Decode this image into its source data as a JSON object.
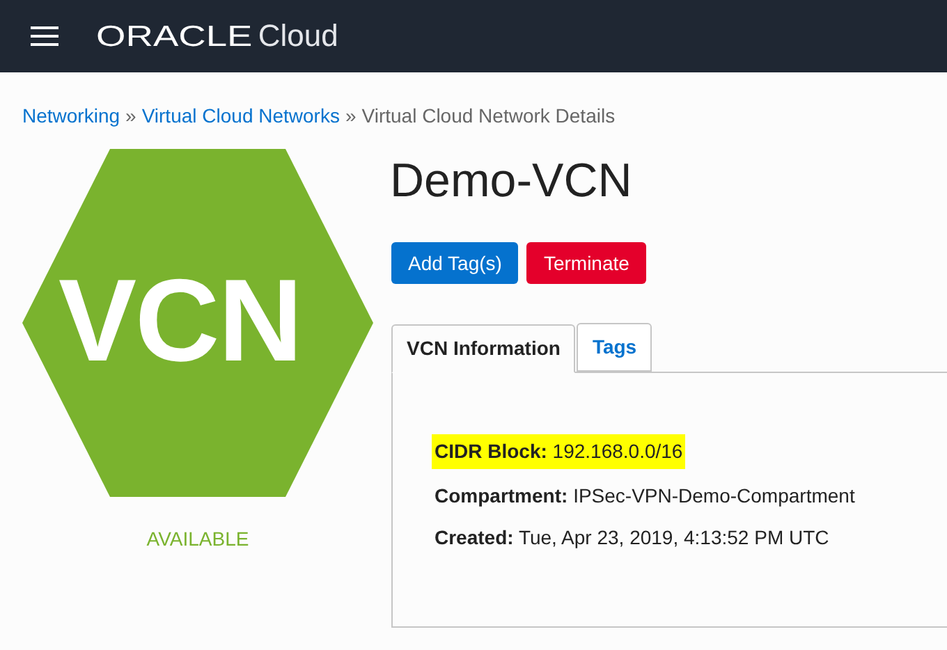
{
  "header": {
    "brand": "ORACLE",
    "product": "Cloud"
  },
  "breadcrumb": [
    {
      "label": "Networking",
      "link": true
    },
    {
      "separator": "»"
    },
    {
      "label": "Virtual Cloud Networks",
      "link": true
    },
    {
      "separator": "»"
    },
    {
      "label": "Virtual Cloud Network Details",
      "link": false
    }
  ],
  "resource": {
    "icon_text": "VCN",
    "status": "AVAILABLE",
    "title": "Demo-VCN"
  },
  "buttons": [
    {
      "label": "Add Tag(s)",
      "kind": "primary"
    },
    {
      "label": "Terminate",
      "kind": "danger"
    }
  ],
  "tabs": [
    {
      "label": "VCN Information",
      "selected": true
    },
    {
      "label": "Tags",
      "selected": false
    }
  ],
  "fields": [
    {
      "label": "CIDR Block:",
      "value": "192.168.0.0/16",
      "highlighted": true
    },
    {
      "label": "Compartment:",
      "value": "IPSec-VPN-Demo-Compartment",
      "highlighted": false
    },
    {
      "label": "Created:",
      "value": "Tue, Apr 23, 2019, 4:13:52 PM UTC",
      "highlighted": false
    }
  ]
}
